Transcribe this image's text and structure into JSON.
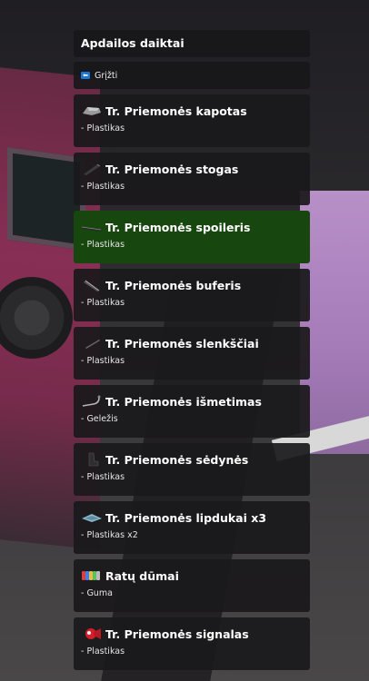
{
  "menu": {
    "title": "Apdailos daiktai",
    "back_label": "Grįžti",
    "items": [
      {
        "label": "Tr. Priemonės kapotas",
        "sub": "- Plastikas",
        "icon": "hood-icon"
      },
      {
        "label": "Tr. Priemonės stogas",
        "sub": "- Plastikas",
        "icon": "roof-icon"
      },
      {
        "label": "Tr. Priemonės spoileris",
        "sub": "- Plastikas",
        "icon": "spoiler-icon"
      },
      {
        "label": "Tr. Priemonės buferis",
        "sub": "- Plastikas",
        "icon": "bumper-icon"
      },
      {
        "label": "Tr. Priemonės slenkščiai",
        "sub": "- Plastikas",
        "icon": "skirt-icon"
      },
      {
        "label": "Tr. Priemonės išmetimas",
        "sub": "- Geležis",
        "icon": "exhaust-icon"
      },
      {
        "label": "Tr. Priemonės sėdynės",
        "sub": "- Plastikas",
        "icon": "seat-icon"
      },
      {
        "label": "Tr. Priemonės lipdukai x3",
        "sub": "- Plastikas x2",
        "icon": "sticker-icon"
      },
      {
        "label": "Ratų dūmai",
        "sub": "- Guma",
        "icon": "tire-smoke-icon"
      },
      {
        "label": "Tr. Priemonės signalas",
        "sub": "- Plastikas",
        "icon": "horn-icon"
      }
    ]
  },
  "colors": {
    "active": "#17460f",
    "panel": "#1a191b",
    "back_icon": "#1a78d4"
  }
}
